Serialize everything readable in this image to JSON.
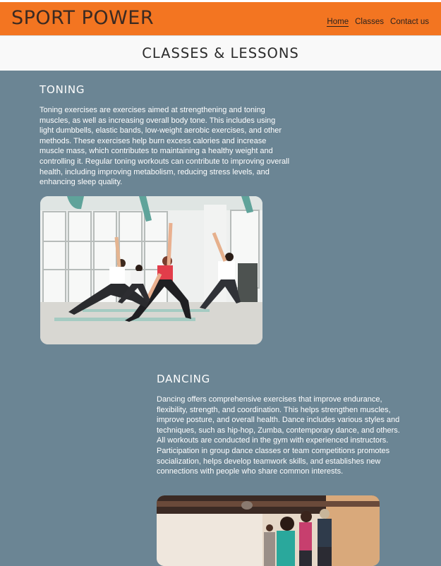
{
  "header": {
    "brand": "SPORT POWER",
    "nav": [
      {
        "label": "Home",
        "active": true
      },
      {
        "label": "Classes",
        "active": false
      },
      {
        "label": "Contact us",
        "active": false
      }
    ],
    "colors": {
      "header_bg": "#f37521",
      "content_bg": "#6b8594"
    }
  },
  "page": {
    "title": "CLASSES & LESSONS"
  },
  "sections": [
    {
      "heading": "TONING",
      "body": "Toning exercises are exercises aimed at strengthening and toning muscles, as well as increasing overall body tone. This includes using light dumbbells, elastic bands, low-weight aerobic exercises, and other methods. These exercises help burn excess calories and increase muscle mass, which contributes to maintaining a healthy weight and controlling it. Regular toning workouts can contribute to improving overall health, including improving metabolism, reducing stress levels, and enhancing sleep quality.",
      "image_icon": "yoga-class-photo"
    },
    {
      "heading": "DANCING",
      "body": "Dancing offers comprehensive exercises that improve endurance, flexibility, strength, and coordination. This helps strengthen muscles, improve posture, and overall health. Dance includes various styles and techniques, such as hip-hop, Zumba, contemporary dance, and others. All workouts are conducted in the gym with experienced instructors. Participation in group dance classes or team competitions promotes socialization, helps develop teamwork skills, and establishes new connections with people who share common interests.",
      "image_icon": "dance-class-photo"
    }
  ]
}
